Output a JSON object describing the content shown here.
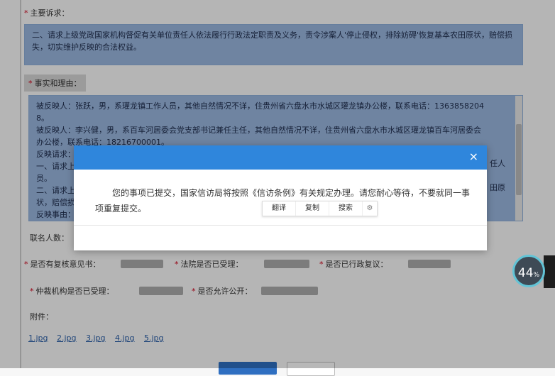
{
  "form": {
    "main_request_label": "主要诉求：",
    "main_request_text": "二、请求上级党政国家机构督促有关单位责任人依法履行行政法定职责及义务，责令涉案人'停止侵权，排除妨碍'恢复基本农田原状，赔偿损失，切实维护反映的合法权益。",
    "facts_label": "事实和理由：",
    "facts_lines": [
      "被反映人：张跃，男，系瓘龙镇工作人员，其他自然情况不详，住贵州省六盘水市水城区瓘龙镇办公楼，联系电话：1363858204",
      "8。",
      "被反映人：李兴健，男，系百车河居委会党支部书记兼任主任，其他自然情况不详，住贵州省六盘水市水城区瓘龙镇百车河居委会",
      "办公楼，联系电话：18216700001。",
      "反映请求：",
      "一、请求上",
      "员。",
      "二、请求上",
      "状，赔偿损",
      "反映事由："
    ],
    "facts_right_fragments": [
      "任人",
      "田原"
    ],
    "contacts_label": "联名人数：",
    "review_label": "是否有复核意见书：",
    "court_label": "法院是否已受理：",
    "admin_review_label": "是否已行政复议：",
    "arbitration_label": "仲裁机构是否已受理：",
    "public_label": "是否允许公开：",
    "attachments_label": "附件：",
    "attachments": [
      "1.jpg",
      "2.jpg",
      "3.jpg",
      "4.jpg",
      "5.jpg"
    ],
    "required_mark": "*"
  },
  "modal": {
    "message": "您的事项已提交，国家信访局将按照《信访条例》有关规定办理。请您耐心等待，不要就同一事项重复提交。",
    "close_glyph": "×",
    "header_color": "#2f86dc"
  },
  "context_menu": {
    "translate": "翻译",
    "copy": "复制",
    "search": "搜索",
    "settings_glyph": "⚙"
  },
  "widget": {
    "percent": "44",
    "unit": "%"
  }
}
